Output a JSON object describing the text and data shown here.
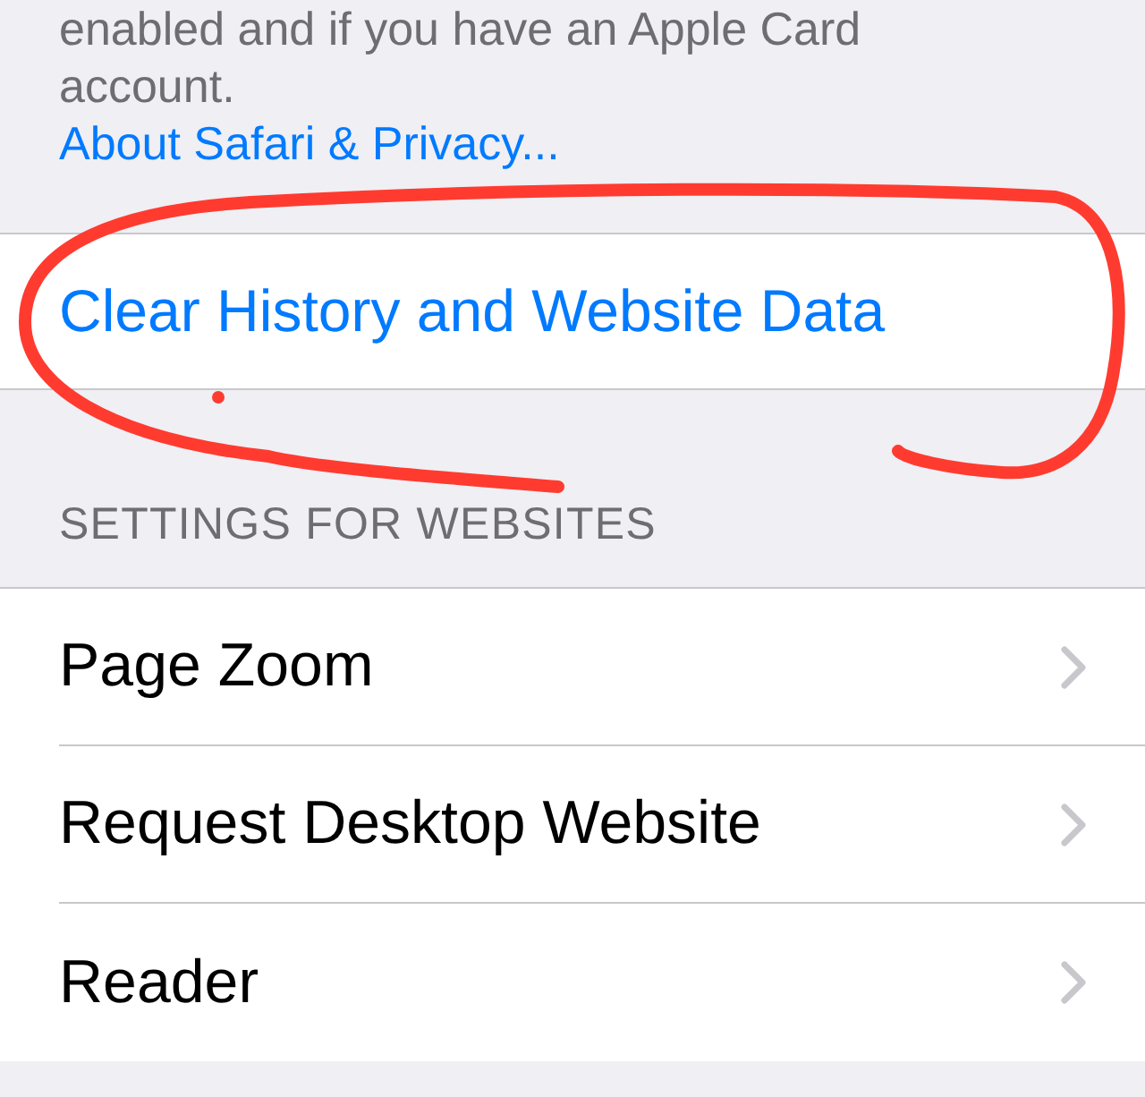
{
  "privacy_note": {
    "lines": [
      "enabled and if you have an Apple Card",
      "account."
    ],
    "link": "About Safari & Privacy..."
  },
  "clear_button": {
    "label": "Clear History and Website Data"
  },
  "section": {
    "header": "SETTINGS FOR WEBSITES",
    "rows": [
      {
        "label": "Page Zoom"
      },
      {
        "label": "Request Desktop Website"
      },
      {
        "label": "Reader"
      }
    ]
  }
}
